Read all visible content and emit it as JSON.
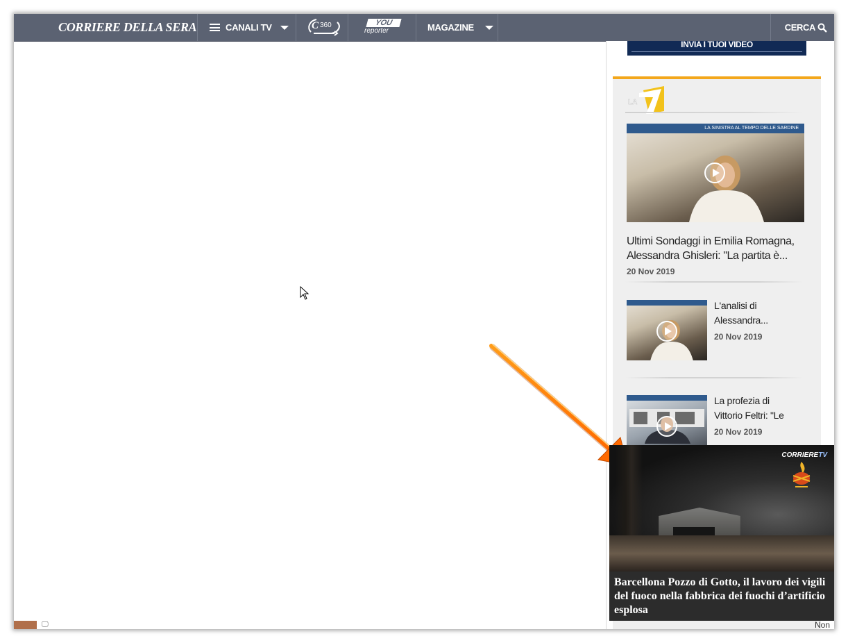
{
  "header": {
    "logo": "CORRIERE DELLA SERA",
    "nav": {
      "channels_label": "CANALI TV",
      "c360_label": "C360",
      "you_top": "YOU",
      "you_bottom": "reporter",
      "magazine_label": "MAGAZINE",
      "search_label": "CERCA"
    }
  },
  "sidebar": {
    "upload_label": "INVIA I TUOI VIDEO",
    "la7_logo": "LA7",
    "main_video": {
      "banner": "LA SINISTRA AL TEMPO DELLE SARDINE",
      "title_line1": "Ultimi Sondaggi in Emilia Romagna,",
      "title_line2": "Alessandra Ghisleri: \"La partita è...",
      "date": "20 Nov 2019"
    },
    "videos": [
      {
        "title_line1": "L'analisi di",
        "title_line2": "Alessandra...",
        "date": "20 Nov 2019"
      },
      {
        "title_line1": "La profezia di",
        "title_line2": "Vittorio Feltri: \"Le",
        "date": "20 Nov 2019"
      }
    ]
  },
  "floating_player": {
    "brand_prefix": "CORRIERE",
    "brand_suffix": "TV",
    "caption": "Barcellona Pozzo di Gotto, il lavoro dei vigili del fuoco nella fabbrica dei fuochi d’artificio esplosa"
  },
  "status": {
    "right_text": "Non"
  },
  "colors": {
    "nav_bg": "#5b6272",
    "accent": "#f3a71b",
    "upload_bg": "#112a55"
  }
}
